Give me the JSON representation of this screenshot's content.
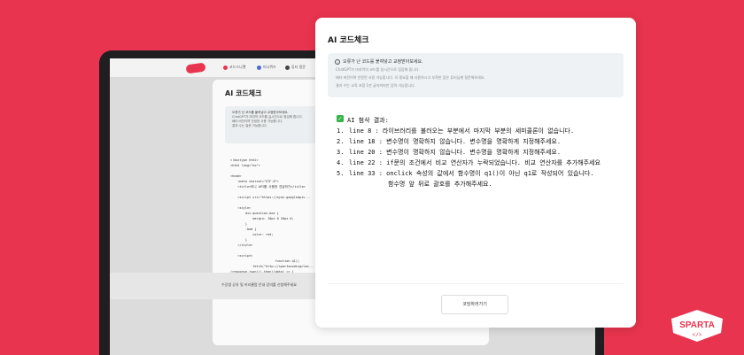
{
  "background": {
    "color": "#e8344e"
  },
  "back_scene": {
    "nav_items": [
      "코드스니펫",
      "미니퀴즈",
      "튜터 질문"
    ],
    "modal_title": "AI 코드체크",
    "info_head": "오류가 난 코드를 붙여넣고 교정받아보세요.",
    "info_lines": [
      "ChatGPT가 마지막 코드를 실시간으로 점검해 줍니다.",
      "베타 버전이며 안정한 사용 가능합니다.",
      "결과 수는 질문 가능합니다."
    ],
    "code": "<!doctype html>\n<html lang=\"ko\">\n\n<head>\n    <meta charset=\"UTF-8\">\n    <title>미니 API를 사용한 연습하기</title>\n\n    <script src=\"https://ajax.googleapis...\n\n    <style>\n        div.question-box {\n            margin: 10px 0 20px 0;\n        }\n        .bad {\n            color: red;\n        }\n    </style>\n\n    <script>\n                        function q1()\n            fetch(\"http://spartacodingclub...\n(response.json()).then((data) => {\n                $('#names-q1').empty()\n\n            rows.forEach((a) => {\n                let gu_name = a['MSRST",
    "footer_text": "수강생 공유 및 커리큘럼 안내 강의를 신청해주세요"
  },
  "modal": {
    "title": "AI 코드체크",
    "info": {
      "head": "오류가 난 코드를 붙여넣고 교정받아보세요.",
      "lines": [
        "ChatGPT가 마지막의 코드를 실시간으로 점검해 줍니다.",
        "베타 버전이며 안정된 사용 가능합니다. 꼭 필요할 때 사용하시고 부족한 점은 튜터님께 질문해보세요.",
        "결과 수는 교육 포함 1만 글자까지만 입력 가능합니다."
      ]
    },
    "result": {
      "header": "AI 첨삭 결과:",
      "items": [
        {
          "num": "1.",
          "text": "line 8 : 라이브러리를 불러오는 부분에서 마지막 부분의 세미콜론이 없습니다."
        },
        {
          "num": "2.",
          "text": "line 18 : 변수명이 명확하지 않습니다. 변수명을 명확하게 지정해주세요."
        },
        {
          "num": "3.",
          "text": "line 20 : 변수명이 명확하지 않습니다. 변수명을 명확하게 지정해주세요."
        },
        {
          "num": "4.",
          "text": "line 22 : if문의 조건에서 비교 연산자가 누락되었습니다. 비교 연산자를 추가해주세요"
        },
        {
          "num": "5.",
          "text": "line 33 : onclick 속성의 값에서 함수명이 q1()이 아닌 q1로 작성되어 있습니다."
        }
      ],
      "continuation": "함수명 앞 뒤로 괄호를 추가해주세요."
    },
    "confirm_label": "코딩하러가기"
  },
  "badge": {
    "text": "SPARTA",
    "sub": "</>"
  }
}
